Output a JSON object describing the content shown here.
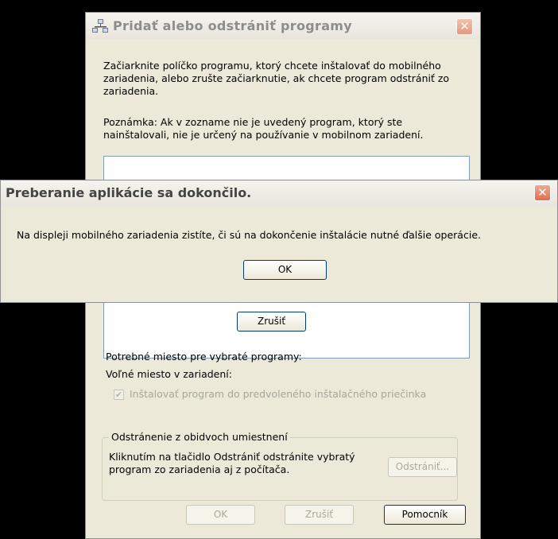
{
  "main_window": {
    "title": "Pridať alebo odstrániť programy",
    "close_symbol": "✕",
    "instructions": "Začiarknite políčko programu, ktorý chcete inštalovať do mobilného zariadenia, alebo zrušte začiarknutie, ak chcete program odstrániť zo zariadenia.",
    "note": "Poznámka: Ak v zozname nie je uvedený program, ktorý ste nainštalovali, nie je určený na používanie v mobilnom zariadení.",
    "cancel_middle_label": "Zrušiť",
    "space_required_label": "Potrebné miesto pre vybraté programy:",
    "space_free_label": "Voľné miesto v zariadení:",
    "install_default_checkbox_label": "Inštalovať program do predvoleného inštalačného priečinka",
    "install_default_checked": true,
    "remove_group": {
      "title": "Odstránenie z obidvoch umiestnení",
      "description": "Kliknutím na tlačidlo Odstrániť odstránite vybratý program zo zariadenia aj z počítača.",
      "remove_button_label": "Odstrániť..."
    },
    "footer_buttons": {
      "ok": "OK",
      "cancel": "Zrušiť",
      "help": "Pomocník"
    }
  },
  "dialog": {
    "title": "Preberanie aplikácie sa dokončilo.",
    "close_symbol": "✕",
    "message": "Na displeji mobilného zariadenia zistíte, či sú na dokončenie inštalácie nutné ďalšie operácie.",
    "ok_label": "OK"
  },
  "icons": {
    "app_icon": "network-programs-icon",
    "close_icon": "close-icon"
  },
  "colors": {
    "window_bg": "#ece9d8",
    "close_red": "#e06d50",
    "disabled_text": "#aca899",
    "desktop": "#000000"
  }
}
